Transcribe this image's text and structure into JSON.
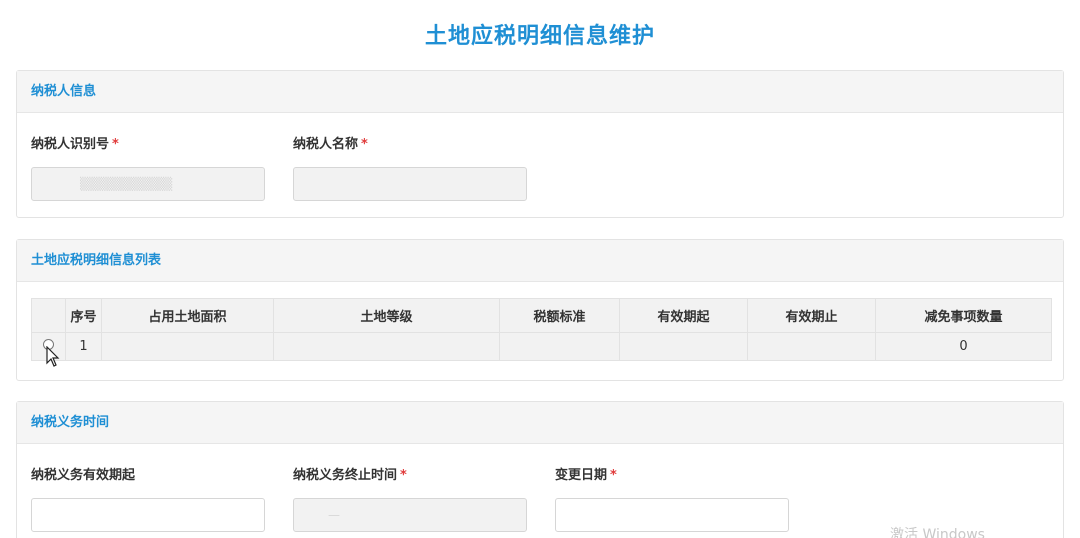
{
  "page": {
    "title": "土地应税明细信息维护"
  },
  "taxpayer_info": {
    "section_title": "纳税人信息",
    "id_label": "纳税人识别号",
    "name_label": "纳税人名称",
    "required_mark": "*"
  },
  "detail_list": {
    "section_title": "土地应税明细信息列表",
    "columns": [
      "",
      "序号",
      "占用土地面积",
      "土地等级",
      "税额标准",
      "有效期起",
      "有效期止",
      "减免事项数量"
    ],
    "rows": [
      {
        "seq": "1",
        "area": "",
        "grade": "",
        "standard": "",
        "start": "",
        "end": "",
        "relief_count": "0"
      }
    ]
  },
  "obligation_time": {
    "section_title": "纳税义务时间",
    "start_label": "纳税义务有效期起",
    "end_label": "纳税义务终止时间",
    "change_label": "变更日期",
    "required_mark": "*"
  },
  "icons": {
    "row_select": "radio-circle-icon",
    "cursor": "mouse-cursor-icon"
  },
  "colors": {
    "accent": "#1f8fd4",
    "required": "#e03b3b"
  },
  "watermark": "激活 Windows"
}
